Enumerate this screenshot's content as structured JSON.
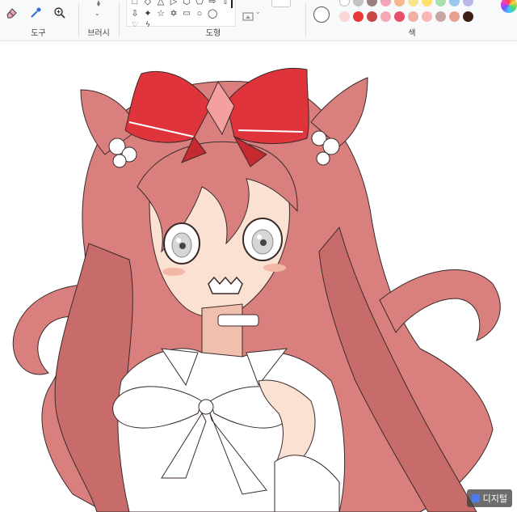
{
  "ribbon": {
    "groups": {
      "tools": "도구",
      "brushes": "브러시",
      "shapes": "도형",
      "colors": "색"
    },
    "shape_glyphs": [
      "□",
      "◇",
      "△",
      "▷",
      "⬡",
      "⬠",
      "⇨",
      "⇦",
      "⇧",
      "⇩",
      "✦",
      "☆",
      "✡",
      "💬",
      "○",
      "◯"
    ],
    "palette_row1": [
      "#ffffff",
      "#c3c3c3",
      "#9a8080",
      "#f4a4b8",
      "#f6b98c",
      "#f5e58d",
      "#ffe06e",
      "#a8dfb0",
      "#9cc6ef",
      "#b8b8e8"
    ],
    "palette_row2": [
      "#f9d7d7",
      "#e83a3a",
      "#c84848",
      "#f6a6b4",
      "#e84d6a",
      "#f0b0a0",
      "#f8b7b7",
      "#c8a6a6",
      "#e8a090",
      "#3c1e14"
    ],
    "selected_color": "#ffffff"
  },
  "canvas": {
    "hair_color": "#d9807f",
    "hair_shade": "#b8605f",
    "bow_color": "#e0343c",
    "skin_color": "#fbe1d2",
    "shirt_color": "#ffffff"
  },
  "watermark": {
    "text": "디지털"
  }
}
